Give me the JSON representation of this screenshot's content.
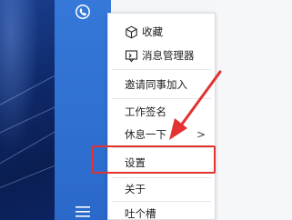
{
  "menu": {
    "items": [
      {
        "label": "收藏",
        "icon": "box-icon"
      },
      {
        "label": "消息管理器",
        "icon": "message-manager-icon"
      },
      {
        "label": "邀请同事加入"
      },
      {
        "label": "工作签名"
      },
      {
        "label": "休息一下",
        "submenu_indicator": ">"
      },
      {
        "label": "设置"
      },
      {
        "label": "关于"
      },
      {
        "label": "吐个槽"
      }
    ]
  },
  "colors": {
    "sidebar": "#2c6fd1",
    "highlight": "#e23232",
    "menu_bg": "#ffffff"
  },
  "icons": {
    "sidebar_logo": "cloud-phone-icon",
    "sidebar_menu": "hamburger-menu-icon"
  }
}
